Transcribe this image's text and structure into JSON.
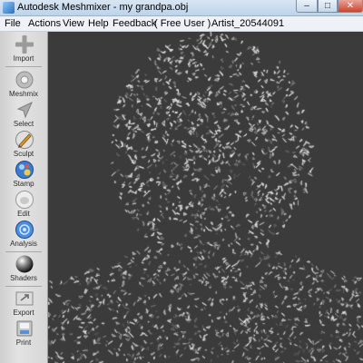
{
  "window": {
    "title": "Autodesk Meshmixer - my grandpa.obj",
    "controls": [
      "–",
      "□",
      "✕"
    ]
  },
  "menu": {
    "items": [
      "File",
      "Actions",
      "View",
      "Help",
      "Feedback",
      "( Free User )",
      "Artist_20544091"
    ]
  },
  "toolbar": {
    "tools": [
      {
        "label": "Import",
        "icon": "import-icon"
      },
      {
        "label": "Meshmix",
        "icon": "meshmix-icon"
      },
      {
        "label": "Select",
        "icon": "select-icon"
      },
      {
        "label": "Sculpt",
        "icon": "sculpt-icon"
      },
      {
        "label": "Stamp",
        "icon": "stamp-icon"
      },
      {
        "label": "Edit",
        "icon": "edit-icon"
      },
      {
        "label": "Analysis",
        "icon": "analysis-icon"
      },
      {
        "label": "Shaders",
        "icon": "shaders-icon"
      },
      {
        "label": "Export",
        "icon": "export-icon"
      },
      {
        "label": "Print",
        "icon": "print-icon"
      }
    ]
  },
  "viewport": {
    "background_color": "#3b3b3b",
    "mesh_color": "#e8e8e8",
    "content": "wireframe-mesh-face-scan"
  }
}
